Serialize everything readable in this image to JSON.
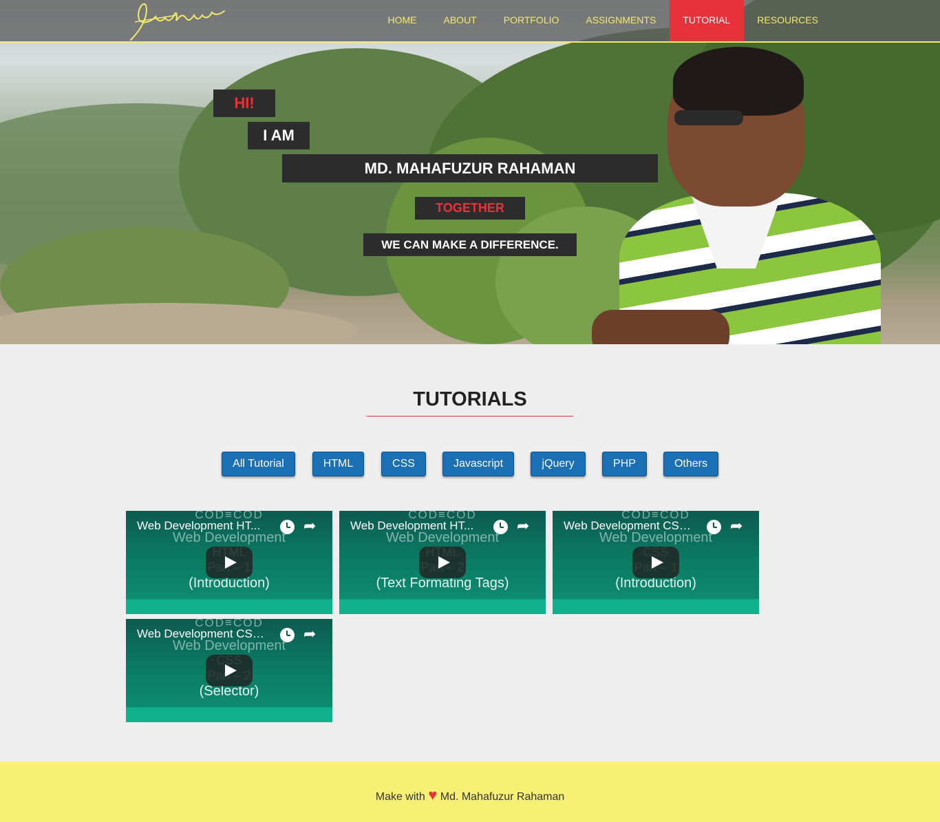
{
  "header": {
    "logo_text": "Mahafuzur",
    "nav": [
      {
        "label": "HOME",
        "active": false
      },
      {
        "label": "ABOUT",
        "active": false
      },
      {
        "label": "PORTFOLIO",
        "active": false
      },
      {
        "label": "ASSIGNMENTS",
        "active": false
      },
      {
        "label": "TUTORIAL",
        "active": true
      },
      {
        "label": "RESOURCES",
        "active": false
      }
    ]
  },
  "hero": {
    "hi": "HI!",
    "i_am": "I AM",
    "name": "MD. MAHAFUZUR RAHAMAN",
    "together": "TOGETHER",
    "difference": "WE CAN MAKE A DIFFERENCE."
  },
  "tutorials": {
    "title": "TUTORIALS",
    "filters": [
      "All Tutorial",
      "HTML",
      "CSS",
      "Javascript",
      "jQuery",
      "PHP",
      "Others"
    ],
    "videos": [
      {
        "title": "Web Development HT...",
        "thumb_top": "COD≡COD",
        "thumb_line1": "Web Development",
        "thumb_line2": "HTML",
        "thumb_line3": "Part – 1",
        "thumb_sub": "(Introduction)"
      },
      {
        "title": "Web Development HT...",
        "thumb_top": "COD≡COD",
        "thumb_line1": "Web Development",
        "thumb_line2": "HTML",
        "thumb_line3": "Part – 2",
        "thumb_sub": "(Text Formating Tags)"
      },
      {
        "title": "Web Development CSS ...",
        "thumb_top": "COD≡COD",
        "thumb_line1": "Web Development",
        "thumb_line2": "CSS",
        "thumb_line3": "Part – 1",
        "thumb_sub": "(Introduction)"
      },
      {
        "title": "Web Development CSS ...",
        "thumb_top": "COD≡COD",
        "thumb_line1": "Web Development",
        "thumb_line2": "CSS",
        "thumb_line3": "Part – 2",
        "thumb_sub": "(Selector)"
      }
    ]
  },
  "footer": {
    "prefix": "Make with",
    "heart": "♥",
    "suffix": "Md. Mahafuzur Rahaman"
  },
  "colors": {
    "accent": "#e8323a",
    "nav_text": "#f4ea6b",
    "button": "#1b6fb4",
    "footer_bg": "#f8f075",
    "video_bg": "#0b7a63"
  }
}
